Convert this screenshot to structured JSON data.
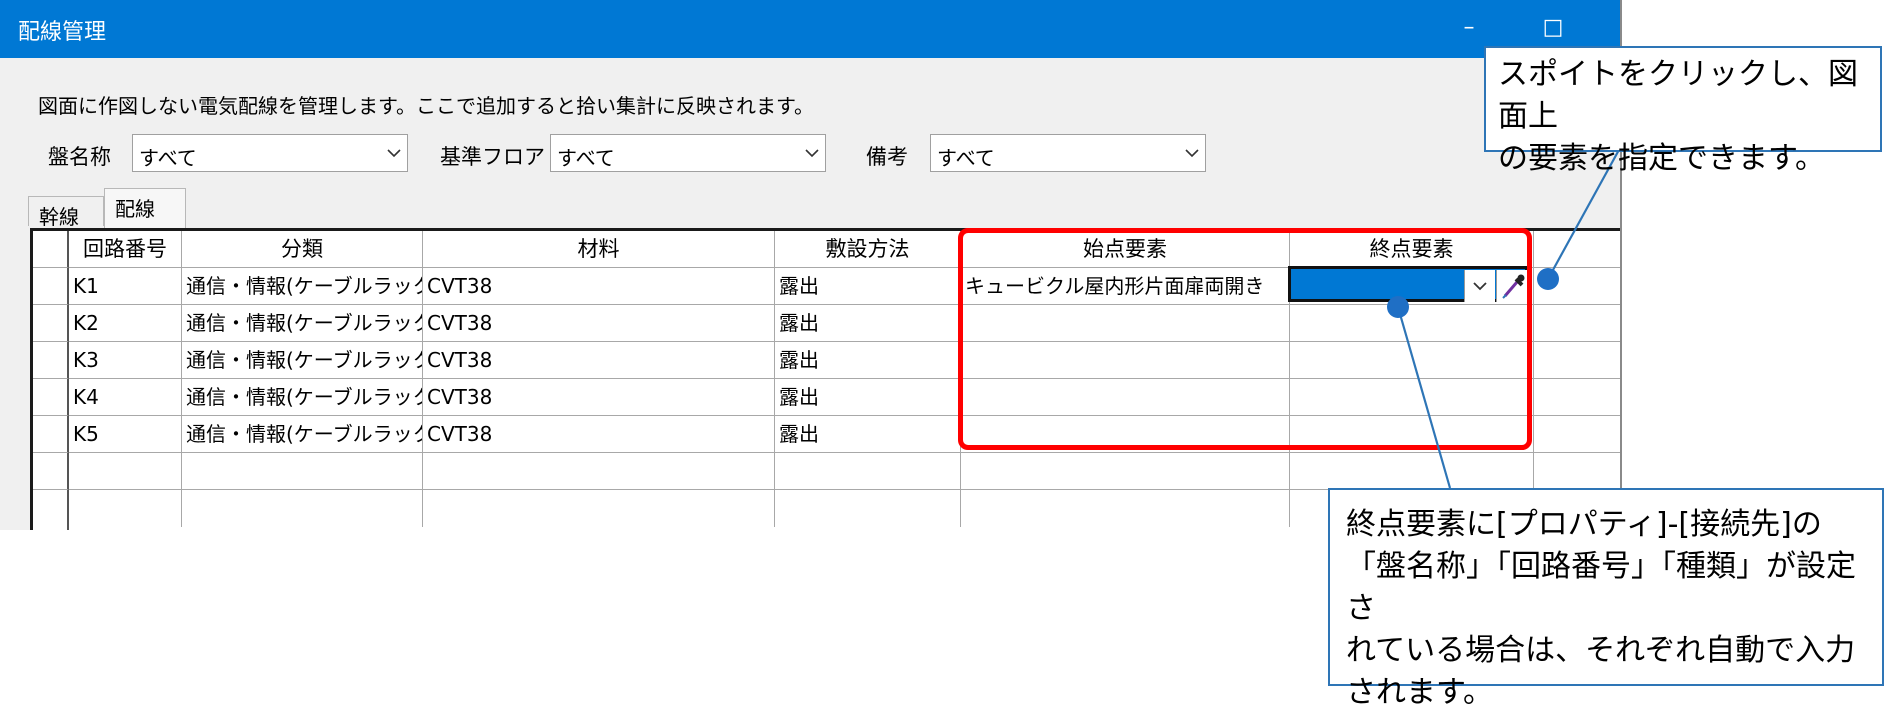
{
  "window": {
    "title": "配線管理"
  },
  "description": "図面に作図しない電気配線を管理します。ここで追加すると拾い集計に反映されます。",
  "filters": [
    {
      "label": "盤名称",
      "value": "すべて"
    },
    {
      "label": "基準フロア",
      "value": "すべて"
    },
    {
      "label": "備考",
      "value": "すべて"
    }
  ],
  "tabs": [
    {
      "label": "幹線",
      "active": false
    },
    {
      "label": "配線",
      "active": true
    }
  ],
  "grid": {
    "columns": [
      "回路番号",
      "分類",
      "材料",
      "敷設方法",
      "始点要素",
      "終点要素"
    ],
    "rows": [
      [
        "K1",
        "通信・情報(ケーブルラック)",
        "CVT38",
        "露出",
        "キュービクル屋内形片面扉両開き",
        ""
      ],
      [
        "K2",
        "通信・情報(ケーブルラック)",
        "CVT38",
        "露出",
        "",
        ""
      ],
      [
        "K3",
        "通信・情報(ケーブルラック)",
        "CVT38",
        "露出",
        "",
        ""
      ],
      [
        "K4",
        "通信・情報(ケーブルラック)",
        "CVT38",
        "露出",
        "",
        ""
      ],
      [
        "K5",
        "通信・情報(ケーブルラック)",
        "CVT38",
        "露出",
        "",
        ""
      ]
    ]
  },
  "callouts": {
    "top": [
      "スポイトをクリックし、図面上",
      "の要素を指定できます。"
    ],
    "bottom": [
      "終点要素に[プロパティ]-[接続先]の",
      "「盤名称」「回路番号」「種類」が設定さ",
      "れている場合は、それぞれ自動で入力",
      "されます。"
    ]
  },
  "colors": {
    "titlebar": "#0078d4",
    "highlight": "#ff0000",
    "callout_border": "#2e75b6",
    "selection": "#0078d4"
  },
  "icons": {
    "dropdown": "chevron-down-icon",
    "picker": "eyedropper-icon"
  }
}
